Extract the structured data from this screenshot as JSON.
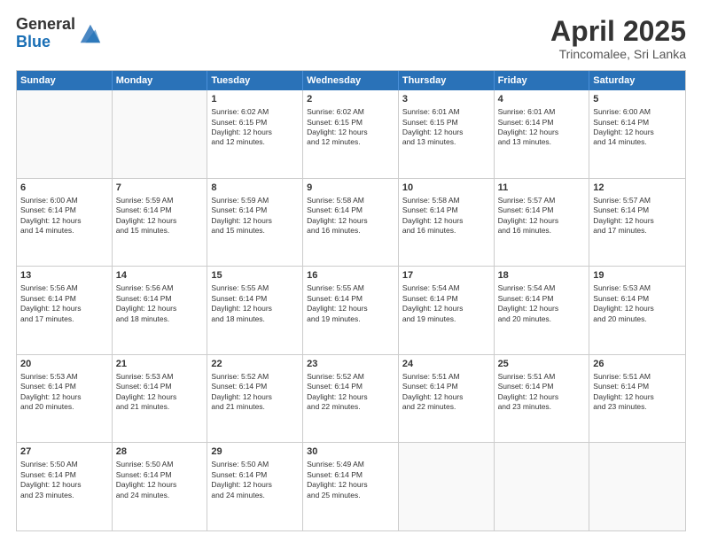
{
  "header": {
    "logo_general": "General",
    "logo_blue": "Blue",
    "title": "April 2025",
    "location": "Trincomalee, Sri Lanka"
  },
  "days_of_week": [
    "Sunday",
    "Monday",
    "Tuesday",
    "Wednesday",
    "Thursday",
    "Friday",
    "Saturday"
  ],
  "weeks": [
    [
      {
        "day": "",
        "empty": true
      },
      {
        "day": "",
        "empty": true
      },
      {
        "day": "1",
        "lines": [
          "Sunrise: 6:02 AM",
          "Sunset: 6:15 PM",
          "Daylight: 12 hours",
          "and 12 minutes."
        ]
      },
      {
        "day": "2",
        "lines": [
          "Sunrise: 6:02 AM",
          "Sunset: 6:15 PM",
          "Daylight: 12 hours",
          "and 12 minutes."
        ]
      },
      {
        "day": "3",
        "lines": [
          "Sunrise: 6:01 AM",
          "Sunset: 6:15 PM",
          "Daylight: 12 hours",
          "and 13 minutes."
        ]
      },
      {
        "day": "4",
        "lines": [
          "Sunrise: 6:01 AM",
          "Sunset: 6:14 PM",
          "Daylight: 12 hours",
          "and 13 minutes."
        ]
      },
      {
        "day": "5",
        "lines": [
          "Sunrise: 6:00 AM",
          "Sunset: 6:14 PM",
          "Daylight: 12 hours",
          "and 14 minutes."
        ]
      }
    ],
    [
      {
        "day": "6",
        "lines": [
          "Sunrise: 6:00 AM",
          "Sunset: 6:14 PM",
          "Daylight: 12 hours",
          "and 14 minutes."
        ]
      },
      {
        "day": "7",
        "lines": [
          "Sunrise: 5:59 AM",
          "Sunset: 6:14 PM",
          "Daylight: 12 hours",
          "and 15 minutes."
        ]
      },
      {
        "day": "8",
        "lines": [
          "Sunrise: 5:59 AM",
          "Sunset: 6:14 PM",
          "Daylight: 12 hours",
          "and 15 minutes."
        ]
      },
      {
        "day": "9",
        "lines": [
          "Sunrise: 5:58 AM",
          "Sunset: 6:14 PM",
          "Daylight: 12 hours",
          "and 16 minutes."
        ]
      },
      {
        "day": "10",
        "lines": [
          "Sunrise: 5:58 AM",
          "Sunset: 6:14 PM",
          "Daylight: 12 hours",
          "and 16 minutes."
        ]
      },
      {
        "day": "11",
        "lines": [
          "Sunrise: 5:57 AM",
          "Sunset: 6:14 PM",
          "Daylight: 12 hours",
          "and 16 minutes."
        ]
      },
      {
        "day": "12",
        "lines": [
          "Sunrise: 5:57 AM",
          "Sunset: 6:14 PM",
          "Daylight: 12 hours",
          "and 17 minutes."
        ]
      }
    ],
    [
      {
        "day": "13",
        "lines": [
          "Sunrise: 5:56 AM",
          "Sunset: 6:14 PM",
          "Daylight: 12 hours",
          "and 17 minutes."
        ]
      },
      {
        "day": "14",
        "lines": [
          "Sunrise: 5:56 AM",
          "Sunset: 6:14 PM",
          "Daylight: 12 hours",
          "and 18 minutes."
        ]
      },
      {
        "day": "15",
        "lines": [
          "Sunrise: 5:55 AM",
          "Sunset: 6:14 PM",
          "Daylight: 12 hours",
          "and 18 minutes."
        ]
      },
      {
        "day": "16",
        "lines": [
          "Sunrise: 5:55 AM",
          "Sunset: 6:14 PM",
          "Daylight: 12 hours",
          "and 19 minutes."
        ]
      },
      {
        "day": "17",
        "lines": [
          "Sunrise: 5:54 AM",
          "Sunset: 6:14 PM",
          "Daylight: 12 hours",
          "and 19 minutes."
        ]
      },
      {
        "day": "18",
        "lines": [
          "Sunrise: 5:54 AM",
          "Sunset: 6:14 PM",
          "Daylight: 12 hours",
          "and 20 minutes."
        ]
      },
      {
        "day": "19",
        "lines": [
          "Sunrise: 5:53 AM",
          "Sunset: 6:14 PM",
          "Daylight: 12 hours",
          "and 20 minutes."
        ]
      }
    ],
    [
      {
        "day": "20",
        "lines": [
          "Sunrise: 5:53 AM",
          "Sunset: 6:14 PM",
          "Daylight: 12 hours",
          "and 20 minutes."
        ]
      },
      {
        "day": "21",
        "lines": [
          "Sunrise: 5:53 AM",
          "Sunset: 6:14 PM",
          "Daylight: 12 hours",
          "and 21 minutes."
        ]
      },
      {
        "day": "22",
        "lines": [
          "Sunrise: 5:52 AM",
          "Sunset: 6:14 PM",
          "Daylight: 12 hours",
          "and 21 minutes."
        ]
      },
      {
        "day": "23",
        "lines": [
          "Sunrise: 5:52 AM",
          "Sunset: 6:14 PM",
          "Daylight: 12 hours",
          "and 22 minutes."
        ]
      },
      {
        "day": "24",
        "lines": [
          "Sunrise: 5:51 AM",
          "Sunset: 6:14 PM",
          "Daylight: 12 hours",
          "and 22 minutes."
        ]
      },
      {
        "day": "25",
        "lines": [
          "Sunrise: 5:51 AM",
          "Sunset: 6:14 PM",
          "Daylight: 12 hours",
          "and 23 minutes."
        ]
      },
      {
        "day": "26",
        "lines": [
          "Sunrise: 5:51 AM",
          "Sunset: 6:14 PM",
          "Daylight: 12 hours",
          "and 23 minutes."
        ]
      }
    ],
    [
      {
        "day": "27",
        "lines": [
          "Sunrise: 5:50 AM",
          "Sunset: 6:14 PM",
          "Daylight: 12 hours",
          "and 23 minutes."
        ]
      },
      {
        "day": "28",
        "lines": [
          "Sunrise: 5:50 AM",
          "Sunset: 6:14 PM",
          "Daylight: 12 hours",
          "and 24 minutes."
        ]
      },
      {
        "day": "29",
        "lines": [
          "Sunrise: 5:50 AM",
          "Sunset: 6:14 PM",
          "Daylight: 12 hours",
          "and 24 minutes."
        ]
      },
      {
        "day": "30",
        "lines": [
          "Sunrise: 5:49 AM",
          "Sunset: 6:14 PM",
          "Daylight: 12 hours",
          "and 25 minutes."
        ]
      },
      {
        "day": "",
        "empty": true
      },
      {
        "day": "",
        "empty": true
      },
      {
        "day": "",
        "empty": true
      }
    ]
  ]
}
